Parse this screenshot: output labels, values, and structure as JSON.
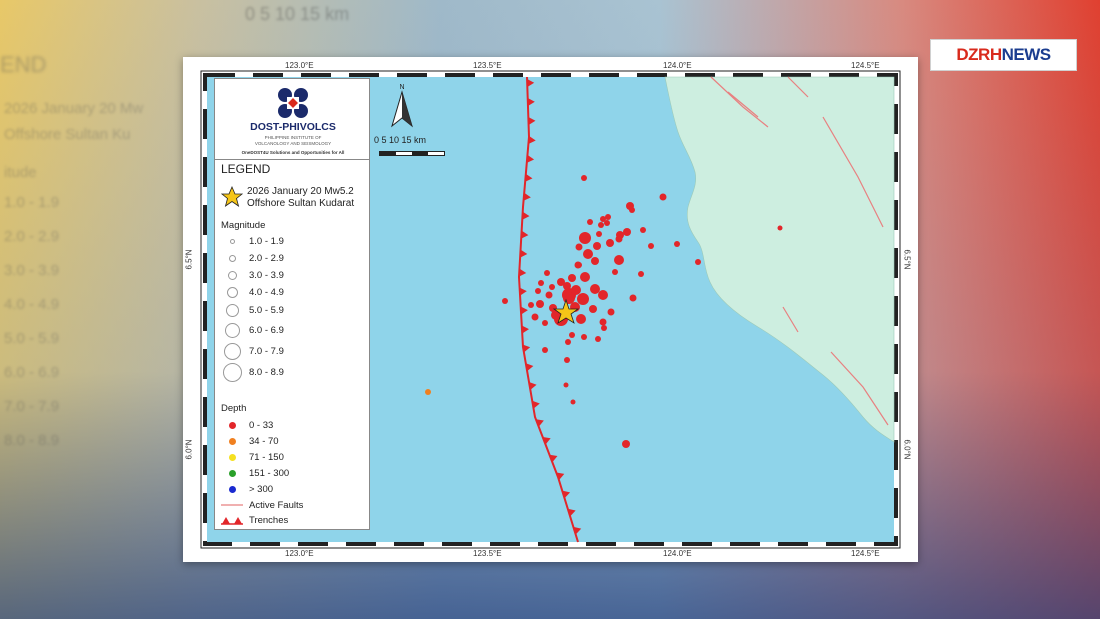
{
  "broadcaster": {
    "logo_dzrh": "DZRH",
    "logo_news": "NEWS"
  },
  "background_ghost": {
    "scale": "0   5   10   15 km",
    "legend": "END",
    "event_line1": "2026 January 20 Mw",
    "event_line2": "Offshore Sultan Ku",
    "magnitude": "itude",
    "rows": [
      "1.0 - 1.9",
      "2.0 - 2.9",
      "3.0 - 3.9",
      "4.0 - 4.9",
      "5.0 - 5.9",
      "6.0 - 6.9",
      "7.0 - 7.9",
      "8.0 - 8.9"
    ]
  },
  "map": {
    "colors": {
      "sea": "#8fd4ea",
      "land": "#cdeee0",
      "trench": "#e2262a",
      "quake_shallow": "#e2262a",
      "quake_intermediate": "#f08020",
      "fault": "#e88080"
    },
    "top_axis": [
      "123.0°E",
      "123.5°E",
      "124.0°E",
      "124.5°E"
    ],
    "bottom_axis": [
      "123.0°E",
      "123.5°E",
      "124.0°E",
      "124.5°E"
    ],
    "left_axis": [
      "6.5°N",
      "6.0°N"
    ],
    "right_axis": [
      "6.5°N",
      "6.0°N"
    ],
    "north_label": "N",
    "scale_text": "0   5   10   15 km",
    "legend": {
      "org_name": "DOST-PHIVOLCS",
      "org_sub1": "PHILIPPINE INSTITUTE OF",
      "org_sub2": "VOLCANOLOGY AND SEISMOLOGY",
      "org_tag": "OneDOST4U Solutions and Opportunities for All",
      "title": "LEGEND",
      "event_line1": "2026 January 20 Mw5.2",
      "event_line2": "Offshore Sultan Kudarat",
      "magnitude_title": "Magnitude",
      "magnitudes": [
        "1.0 - 1.9",
        "2.0 - 2.9",
        "3.0 - 3.9",
        "4.0 - 4.9",
        "5.0 - 5.9",
        "6.0 - 6.9",
        "7.0 - 7.9",
        "8.0 - 8.9"
      ],
      "depth_title": "Depth",
      "depths": [
        {
          "label": "0 - 33",
          "color": "#e2262a"
        },
        {
          "label": "34 - 70",
          "color": "#f08020"
        },
        {
          "label": "71 - 150",
          "color": "#f5e020"
        },
        {
          "label": "151 - 300",
          "color": "#2aa02a"
        },
        {
          "label": "> 300",
          "color": "#1a2ad0"
        }
      ],
      "active_faults": "Active Faults",
      "trenches": "Trenches"
    }
  }
}
